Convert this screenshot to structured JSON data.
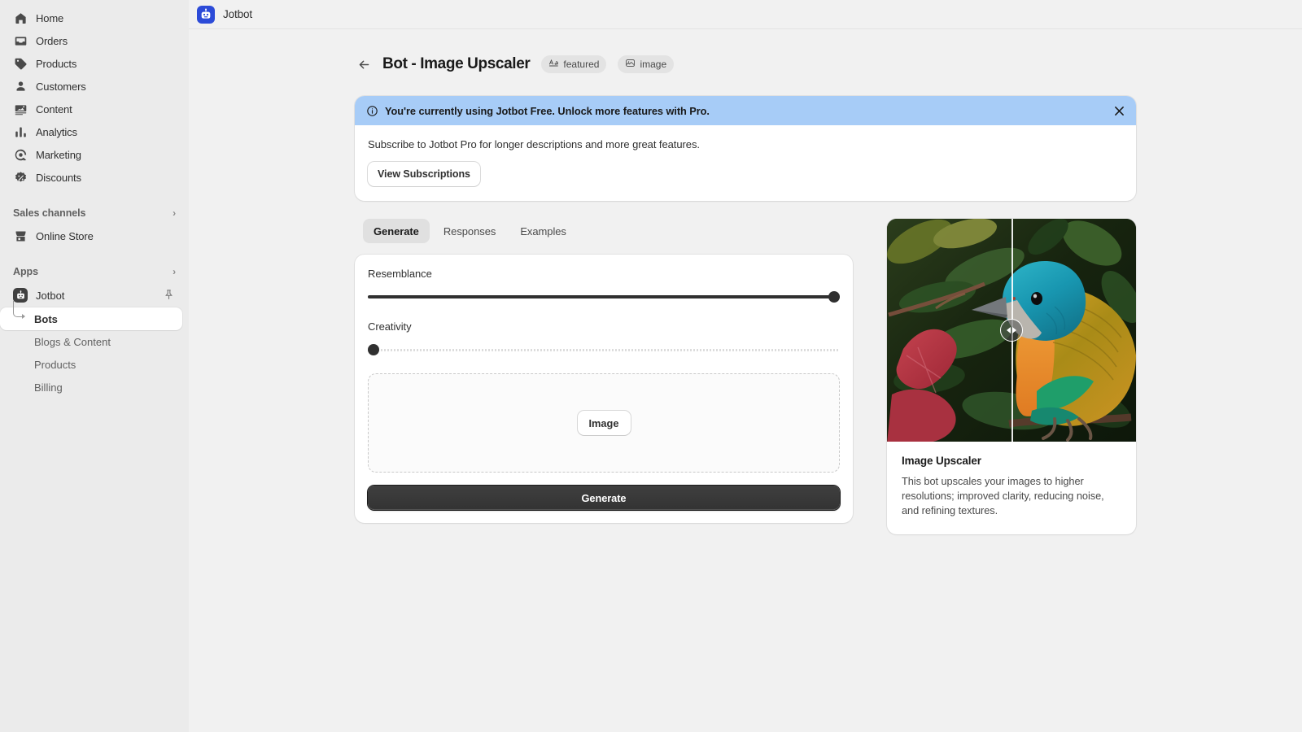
{
  "topbar": {
    "app_name": "Jotbot",
    "logo_color": "#2c4bd8",
    "logo_icon": "robot-icon"
  },
  "sidebar": {
    "items": [
      {
        "label": "Home",
        "icon": "home-icon"
      },
      {
        "label": "Orders",
        "icon": "orders-inbox-icon"
      },
      {
        "label": "Products",
        "icon": "product-tag-icon"
      },
      {
        "label": "Customers",
        "icon": "person-icon"
      },
      {
        "label": "Content",
        "icon": "content-image-icon"
      },
      {
        "label": "Analytics",
        "icon": "bar-chart-icon"
      },
      {
        "label": "Marketing",
        "icon": "megaphone-target-icon"
      },
      {
        "label": "Discounts",
        "icon": "discount-badge-icon"
      }
    ],
    "sections": [
      {
        "title": "Sales channels",
        "chevron": "›",
        "children": [
          {
            "label": "Online Store",
            "icon": "storefront-icon"
          }
        ]
      },
      {
        "title": "Apps",
        "chevron": "›"
      }
    ],
    "app": {
      "label": "Jotbot",
      "pin_icon": "pin-icon",
      "children": [
        {
          "label": "Bots",
          "active": true
        },
        {
          "label": "Blogs & Content",
          "active": false
        },
        {
          "label": "Products",
          "active": false
        },
        {
          "label": "Billing",
          "active": false
        }
      ]
    }
  },
  "page": {
    "back_icon": "arrow-left-icon",
    "title": "Bot - Image Upscaler",
    "badges": [
      {
        "label": "featured",
        "icon": "text-style-icon"
      },
      {
        "label": "image",
        "icon": "image-icon"
      }
    ]
  },
  "banner": {
    "icon": "info-circle-icon",
    "headline": "You're currently using Jotbot Free. Unlock more features with Pro.",
    "body": "Subscribe to Jotbot Pro for longer descriptions and more great features.",
    "action_label": "View Subscriptions",
    "close_icon": "close-icon",
    "header_color": "#a7ccf7"
  },
  "tabs": [
    {
      "label": "Generate",
      "active": true
    },
    {
      "label": "Responses",
      "active": false
    },
    {
      "label": "Examples",
      "active": false
    }
  ],
  "generate": {
    "resemblance": {
      "label": "Resemblance",
      "value": 100,
      "min": 0,
      "max": 100
    },
    "creativity": {
      "label": "Creativity",
      "value": 0,
      "min": 0,
      "max": 100
    },
    "dropzone": {
      "button_label": "Image"
    },
    "submit_label": "Generate"
  },
  "preview": {
    "title": "Image Upscaler",
    "description": "This bot upscales your images to higher resolutions; improved clarity, reducing noise, and refining textures.",
    "comparison_handle_icon": "compare-slider-icon",
    "image_alt": "Colorful blue and orange tanager bird perched on a branch among green and red leaves"
  }
}
